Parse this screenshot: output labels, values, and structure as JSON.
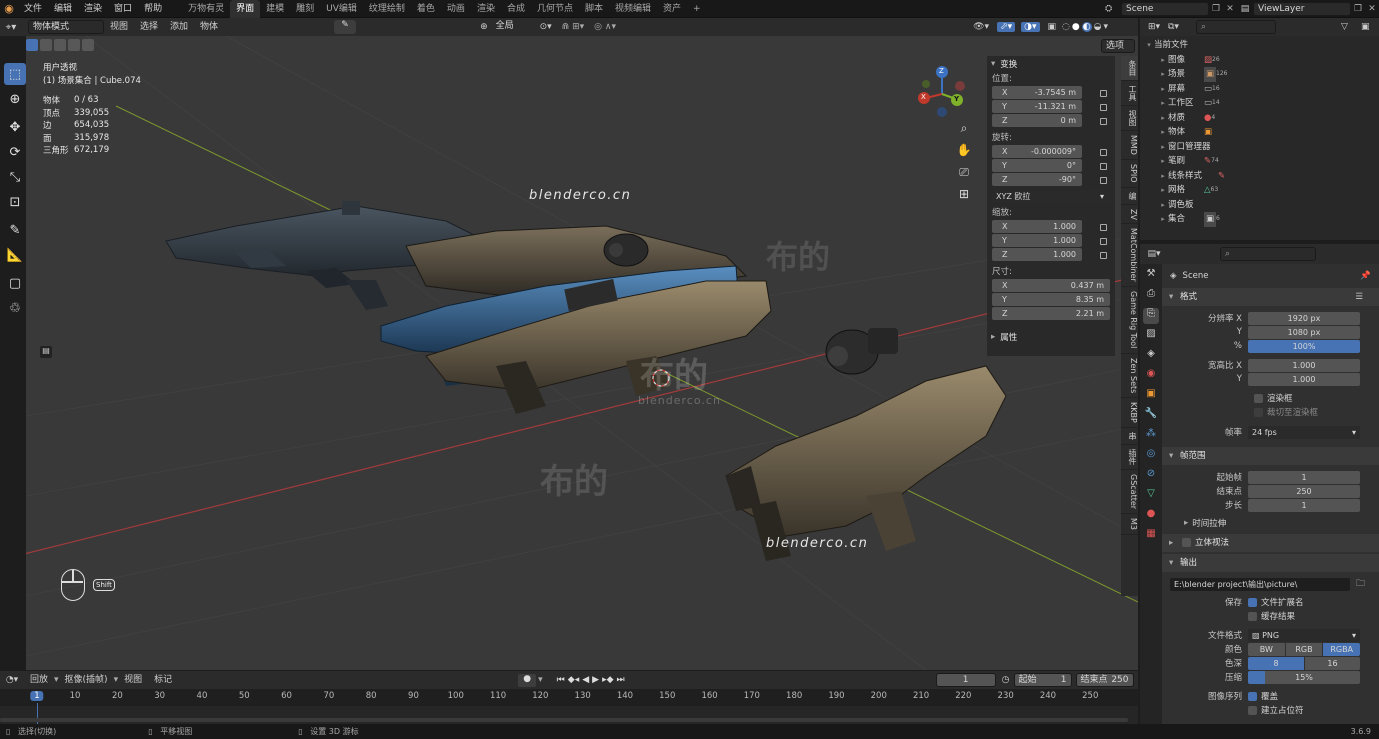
{
  "topbar": {
    "menus": [
      "文件",
      "编辑",
      "渲染",
      "窗口",
      "帮助"
    ],
    "workspaces": [
      "万物有灵",
      "界面",
      "建模",
      "雕刻",
      "UV编辑",
      "纹理绘制",
      "着色",
      "动画",
      "渲染",
      "合成",
      "几何节点",
      "脚本",
      "视频编辑",
      "资产"
    ],
    "active_workspace": "界面",
    "add_tab": "+",
    "scene_name": "Scene",
    "view_layer": "ViewLayer"
  },
  "viewport_header": {
    "mode": "物体模式",
    "menus": [
      "视图",
      "选择",
      "添加",
      "物体"
    ],
    "transform_orientation": "全局",
    "options_label": "选项"
  },
  "viewport": {
    "view_name": "用户透视",
    "collection_info": "(1) 场景集合 | Cube.074",
    "stats": [
      {
        "label": "物体",
        "value": "0 / 63"
      },
      {
        "label": "顶点",
        "value": "339,055"
      },
      {
        "label": "边",
        "value": "654,035"
      },
      {
        "label": "面",
        "value": "315,978"
      },
      {
        "label": "三角形",
        "value": "672,179"
      }
    ],
    "watermark1": "blenderco.cn",
    "watermark2": "blenderco.cn",
    "watermark_center": "blenderco.cn",
    "watermark_cn1": "布的",
    "watermark_cn2": "布的",
    "watermark_cn3": "布的",
    "key_hint": "Shift",
    "gizmo": {
      "x": "X",
      "y": "Y",
      "z": "Z"
    }
  },
  "npanel": {
    "transform_title": "变换",
    "location_label": "位置:",
    "location": [
      {
        "axis": "X",
        "value": "-3.7545 m"
      },
      {
        "axis": "Y",
        "value": "-11.321 m"
      },
      {
        "axis": "Z",
        "value": "0 m"
      }
    ],
    "rotation_label": "旋转:",
    "rotation": [
      {
        "axis": "X",
        "value": "-0.000009°"
      },
      {
        "axis": "Y",
        "value": "0°"
      },
      {
        "axis": "Z",
        "value": "-90°"
      }
    ],
    "rotation_mode": "XYZ 欧拉",
    "scale_label": "缩放:",
    "scale": [
      {
        "axis": "X",
        "value": "1.000"
      },
      {
        "axis": "Y",
        "value": "1.000"
      },
      {
        "axis": "Z",
        "value": "1.000"
      }
    ],
    "dimensions_label": "尺寸:",
    "dimensions": [
      {
        "axis": "X",
        "value": "0.437 m"
      },
      {
        "axis": "Y",
        "value": "8.35 m"
      },
      {
        "axis": "Z",
        "value": "2.21 m"
      }
    ],
    "properties_title": "属性"
  },
  "side_tabs": [
    "条目",
    "工具",
    "视图",
    "MMD",
    "SPIO",
    "编",
    "ZV",
    "MatCombiner",
    "Game Rig Tool",
    "Zen Sets",
    "KKBP",
    "串",
    "插件",
    "GScatter",
    "M3"
  ],
  "outliner": {
    "root": "当前文件",
    "items": [
      "图像",
      "场景",
      "屏幕",
      "工作区",
      "材质",
      "物体",
      "窗口管理器",
      "笔刷",
      "线条样式",
      "网格",
      "调色板",
      "集合"
    ],
    "counts": [
      "26",
      "126",
      "16",
      "14",
      "4",
      "",
      "",
      "74",
      "",
      "63",
      "",
      "6"
    ]
  },
  "properties": {
    "scene_name": "Scene",
    "format_title": "格式",
    "res_x_label": "分辨率 X",
    "res_x": "1920 px",
    "res_y_label": "Y",
    "res_y": "1080 px",
    "res_pct_label": "%",
    "res_pct": "100%",
    "aspect_x_label": "宽高比 X",
    "aspect_x": "1.000",
    "aspect_y_label": "Y",
    "aspect_y": "1.000",
    "render_region": "渲染框",
    "crop_region": "裁切至渲染框",
    "fps_label": "帧率",
    "fps": "24 fps",
    "frame_range_title": "帧范围",
    "frame_start_label": "起始帧",
    "frame_start": "1",
    "frame_end_label": "结束点",
    "frame_end": "250",
    "frame_step_label": "步长",
    "frame_step": "1",
    "time_stretch": "时间拉伸",
    "stereo": "立体视法",
    "output_title": "输出",
    "output_path": "E:\\blender project\\输出\\picture\\",
    "save_label": "保存",
    "file_ext": "文件扩展名",
    "cache_result": "缓存结果",
    "file_format_label": "文件格式",
    "file_format": "PNG",
    "color_label": "颜色",
    "color_opts": [
      "BW",
      "RGB",
      "RGBA"
    ],
    "depth_label": "色深",
    "depth_opts": [
      "8",
      "16"
    ],
    "compress_label": "压缩",
    "compress": "15%",
    "compress_fraction": 0.15,
    "sequence_label": "图像序列",
    "overwrite": "覆盖",
    "placeholders": "建立占位符"
  },
  "timeline": {
    "menus": [
      "回放",
      "抠像(插帧)",
      "视图",
      "标记"
    ],
    "current_frame": "1",
    "start_label": "起始",
    "start": "1",
    "end_label": "结束点",
    "end": "250",
    "ticks": [
      "1",
      "10",
      "20",
      "30",
      "40",
      "50",
      "60",
      "70",
      "80",
      "90",
      "100",
      "110",
      "120",
      "130",
      "140",
      "150",
      "160",
      "170",
      "180",
      "190",
      "200",
      "210",
      "220",
      "230",
      "240",
      "250"
    ]
  },
  "statusbar": {
    "select": "选择(切换)",
    "pan": "平移视图",
    "cursor": "设置 3D 游标",
    "version": "3.6.9"
  },
  "colors": {
    "accent": "#4772b3",
    "x_axis": "#c0392b",
    "y_axis": "#7fb12a",
    "z_axis": "#3c72c4"
  }
}
